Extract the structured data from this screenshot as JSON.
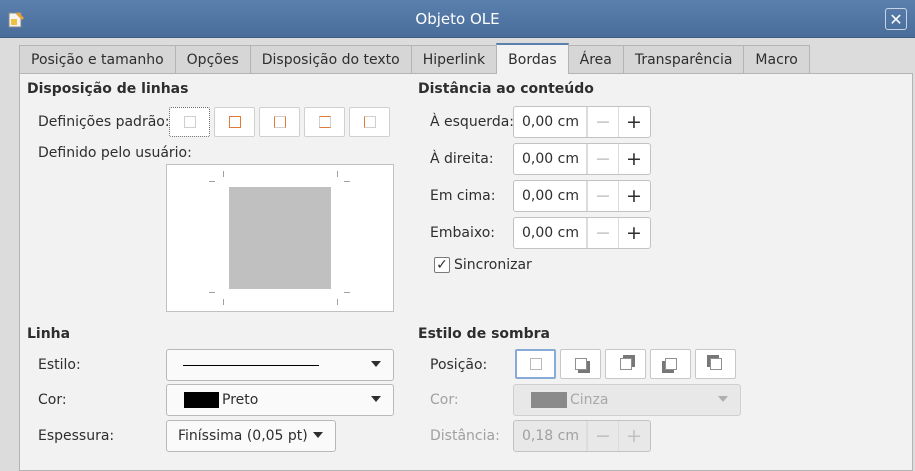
{
  "window": {
    "title": "Objeto OLE",
    "app_icon": "draw-app-icon",
    "close_icon": "close-icon"
  },
  "tabs": [
    {
      "label": "Posição e tamanho"
    },
    {
      "label": "Opções"
    },
    {
      "label": "Disposição do texto"
    },
    {
      "label": "Hiperlink"
    },
    {
      "label": "Bordas",
      "active": true
    },
    {
      "label": "Área"
    },
    {
      "label": "Transparência"
    },
    {
      "label": "Macro"
    }
  ],
  "line_arrangement": {
    "title": "Disposição de linhas",
    "presets_label": "Definições padrão:",
    "user_label": "Definido pelo usuário:"
  },
  "padding": {
    "title": "Distância ao conteúdo",
    "left_label": "À esquerda:",
    "left_value": "0,00 cm",
    "right_label": "À direita:",
    "right_value": "0,00 cm",
    "top_label": "Em cima:",
    "top_value": "0,00 cm",
    "bottom_label": "Embaixo:",
    "bottom_value": "0,00 cm",
    "sync_label": "Sincronizar",
    "sync_checked": true,
    "minus": "−",
    "plus": "+"
  },
  "line": {
    "title": "Linha",
    "style_label": "Estilo:",
    "color_label": "Cor:",
    "color_value": "Preto",
    "color_swatch": "#000000",
    "width_label": "Espessura:",
    "width_value": "Finíssima (0,05 pt)"
  },
  "shadow": {
    "title": "Estilo de sombra",
    "position_label": "Posição:",
    "color_label": "Cor:",
    "color_value": "Cinza",
    "color_swatch": "#808080",
    "distance_label": "Distância:",
    "distance_value": "0,18 cm"
  },
  "colors": {
    "accent": "#5b80ae",
    "preset_line": "#e07b39"
  }
}
